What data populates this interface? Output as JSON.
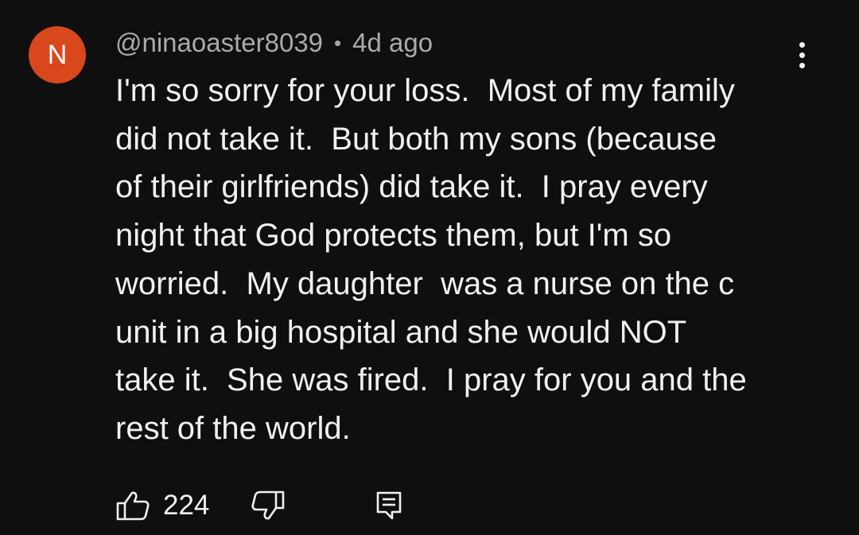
{
  "comment": {
    "avatar_letter": "N",
    "avatar_color": "#d9481c",
    "author": "@ninaoaster8039",
    "separator": "•",
    "timestamp": "4d ago",
    "lines": [
      "I'm so sorry for your loss.  Most of my family",
      "did not take it.  But both my sons (because",
      "of their girlfriends) did take it.  I pray every",
      "night that God protects them, but I'm so",
      "worried.  My daughter  was a nurse on the c",
      "unit in a big hospital and she would NOT",
      "take it.  She was fired.  I pray for you and the",
      "rest of the world."
    ],
    "more_icon": "kebab-vertical-icon"
  },
  "actions": {
    "like_icon": "thumbs-up-icon",
    "like_count": "224",
    "dislike_icon": "thumbs-down-icon",
    "reply_icon": "reply-comment-icon"
  },
  "colors": {
    "background": "#0f0f0f",
    "text": "#f1f1f1",
    "secondary_text": "#aaaaaa"
  }
}
